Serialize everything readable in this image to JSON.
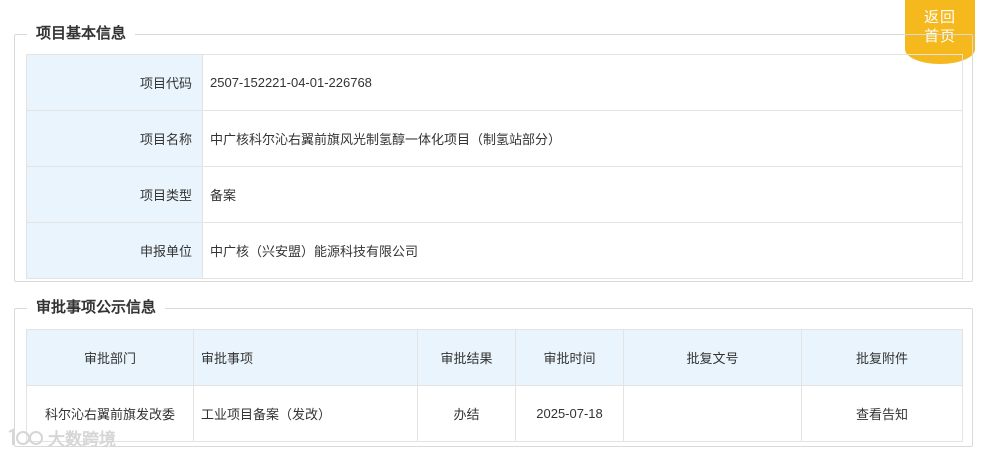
{
  "back_button": {
    "line1": "返回",
    "line2": "首页"
  },
  "basic_info": {
    "legend": "项目基本信息",
    "rows": [
      {
        "label": "项目代码",
        "value": "2507-152221-04-01-226768"
      },
      {
        "label": "项目名称",
        "value": "中广核科尔沁右翼前旗风光制氢醇一体化项目（制氢站部分）"
      },
      {
        "label": "项目类型",
        "value": "备案"
      },
      {
        "label": "申报单位",
        "value": "中广核（兴安盟）能源科技有限公司"
      }
    ]
  },
  "approval_info": {
    "legend": "审批事项公示信息",
    "headers": [
      "审批部门",
      "审批事项",
      "审批结果",
      "审批时间",
      "批复文号",
      "批复附件"
    ],
    "rows": [
      {
        "dept": "科尔沁右翼前旗发改委",
        "item": "工业项目备案（发改）",
        "result": "办结",
        "time": "2025-07-18",
        "doc_no": "",
        "attachment": "查看告知"
      }
    ]
  },
  "watermark": {
    "text": "大数跨境",
    "icon": "brand-logo-icon"
  }
}
